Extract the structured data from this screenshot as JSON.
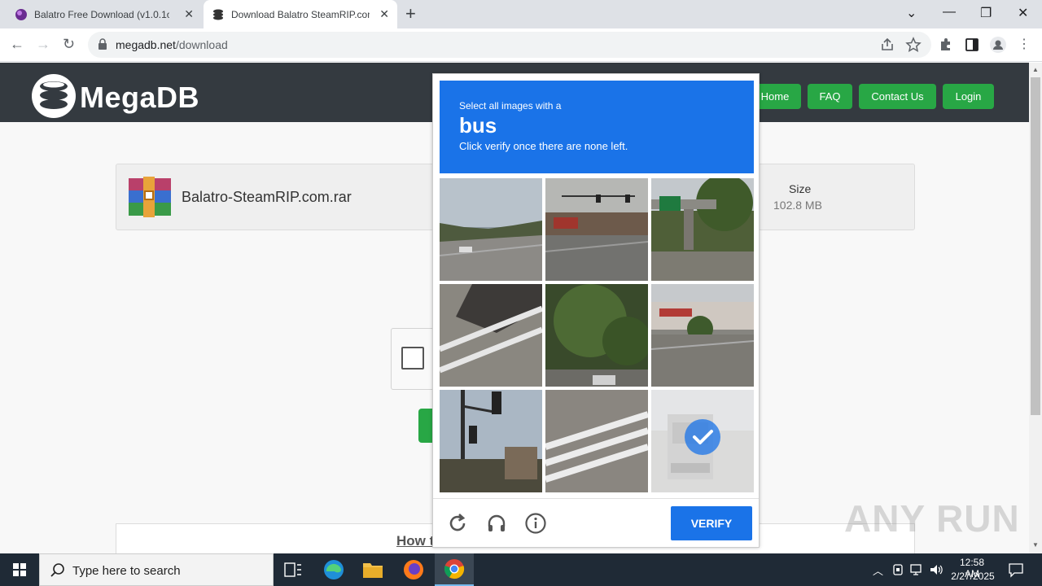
{
  "browser": {
    "tabs": [
      {
        "title": "Balatro Free Download (v1.0.1o)",
        "active": false
      },
      {
        "title": "Download Balatro SteamRIP.com",
        "active": true
      }
    ],
    "url_host": "megadb.net",
    "url_path": "/download"
  },
  "site": {
    "logo": "MegaDB",
    "nav": [
      "Home",
      "FAQ",
      "Contact Us",
      "Login"
    ],
    "accent": "#28a745",
    "header_bg": "#343a40"
  },
  "file": {
    "name": "Balatro-SteamRIP.com.rar",
    "size_label": "Size",
    "size_value": "102.8 MB"
  },
  "howto_text": "How t",
  "captcha": {
    "line1": "Select all images with a",
    "target": "bus",
    "line3": "Click verify once there are none left.",
    "verify_label": "VERIFY",
    "accent": "#1a73e8",
    "tiles": [
      {
        "index": 1,
        "scene": "road-trees-sky",
        "selected": false
      },
      {
        "index": 2,
        "scene": "intersection-traffic-lights",
        "selected": false
      },
      {
        "index": 3,
        "scene": "overpass-green-sign",
        "selected": false
      },
      {
        "index": 4,
        "scene": "pole-shadow-crosswalk",
        "selected": false
      },
      {
        "index": 5,
        "scene": "tree-and-car",
        "selected": false
      },
      {
        "index": 6,
        "scene": "storefront-road",
        "selected": false
      },
      {
        "index": 7,
        "scene": "traffic-light-pole",
        "selected": false
      },
      {
        "index": 8,
        "scene": "crosswalk-stripes",
        "selected": false
      },
      {
        "index": 9,
        "scene": "bus-rear",
        "selected": true
      }
    ]
  },
  "watermark": "ANY RUN",
  "taskbar": {
    "search_placeholder": "Type here to search",
    "time": "12:58 AM",
    "date": "2/27/2025"
  }
}
